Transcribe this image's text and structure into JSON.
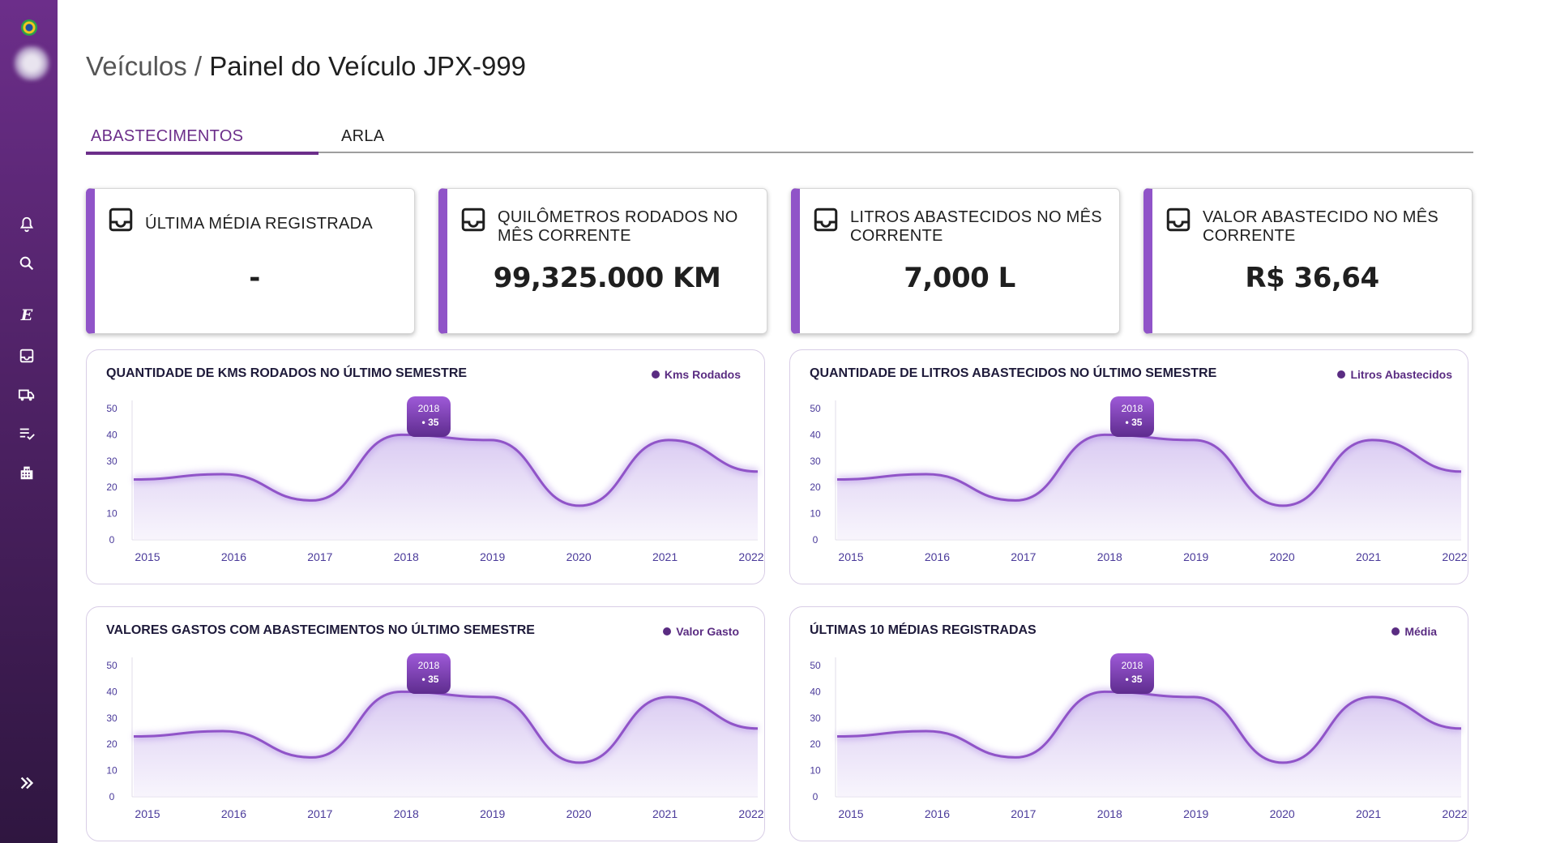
{
  "breadcrumb": {
    "parent": "Veículos",
    "separator": " / ",
    "current": "Painel do Veículo JPX-999"
  },
  "tabs": [
    {
      "label": "ABASTECIMENTOS",
      "active": true
    },
    {
      "label": "ARLA",
      "active": false
    }
  ],
  "sidebar": {
    "icons": [
      "flag-icon",
      "avatar",
      "bell-icon",
      "search-icon",
      "e-icon",
      "inbox-icon",
      "truck-icon",
      "checklist-icon",
      "building-icon",
      "double-chevron-right-icon"
    ],
    "e_label": "E"
  },
  "cards": [
    {
      "title": "ÚLTIMA MÉDIA REGISTRADA",
      "value": "-"
    },
    {
      "title": "QUILÔMETROS RODADOS NO MÊS CORRENTE",
      "value": "99,325.000 KM"
    },
    {
      "title": "LITROS ABASTECIDOS NO MÊS CORRENTE",
      "value": "7,000 L"
    },
    {
      "title": "VALOR ABASTECIDO NO MÊS CORRENTE",
      "value": "R$ 36,64"
    }
  ],
  "colors": {
    "accent": "#6c2e8a",
    "line": "#9054c8",
    "card_border": "#9054c8"
  },
  "charts": [
    {
      "title": "QUANTIDADE DE KMS RODADOS  NO ÚLTIMO SEMESTRE",
      "legend": "Kms Rodados",
      "tooltip_year": "2018",
      "tooltip_value": "• 35"
    },
    {
      "title": "QUANTIDADE DE LITROS ABASTECIDOS  NO ÚLTIMO SEMESTRE",
      "legend": "Litros Abastecidos",
      "tooltip_year": "2018",
      "tooltip_value": "• 35"
    },
    {
      "title": "VALORES GASTOS COM ABASTECIMENTOS NO ÚLTIMO SEMESTRE",
      "legend": "Valor Gasto",
      "tooltip_year": "2018",
      "tooltip_value": "• 35"
    },
    {
      "title": "ÚLTIMAS 10 MÉDIAS REGISTRADAS",
      "legend": "Média",
      "tooltip_year": "2018",
      "tooltip_value": "• 35"
    }
  ],
  "chart_data": [
    {
      "type": "area",
      "x": [
        "2015",
        "2016",
        "2017",
        "2018",
        "2019",
        "2020",
        "2021",
        "2022"
      ],
      "series": [
        {
          "name": "Kms Rodados",
          "values": [
            23,
            25,
            15,
            40,
            38,
            13,
            38,
            26
          ]
        }
      ],
      "ylim": [
        0,
        50
      ],
      "yticks": [
        0,
        10,
        20,
        30,
        40,
        50
      ]
    },
    {
      "type": "area",
      "x": [
        "2015",
        "2016",
        "2017",
        "2018",
        "2019",
        "2020",
        "2021",
        "2022"
      ],
      "series": [
        {
          "name": "Litros Abastecidos",
          "values": [
            23,
            25,
            15,
            40,
            38,
            13,
            38,
            26
          ]
        }
      ],
      "ylim": [
        0,
        50
      ],
      "yticks": [
        0,
        10,
        20,
        30,
        40,
        50
      ]
    },
    {
      "type": "area",
      "x": [
        "2015",
        "2016",
        "2017",
        "2018",
        "2019",
        "2020",
        "2021",
        "2022"
      ],
      "series": [
        {
          "name": "Valor Gasto",
          "values": [
            23,
            25,
            15,
            40,
            38,
            13,
            38,
            26
          ]
        }
      ],
      "ylim": [
        0,
        50
      ],
      "yticks": [
        0,
        10,
        20,
        30,
        40,
        50
      ]
    },
    {
      "type": "area",
      "x": [
        "2015",
        "2016",
        "2017",
        "2018",
        "2019",
        "2020",
        "2021",
        "2022"
      ],
      "series": [
        {
          "name": "Média",
          "values": [
            23,
            25,
            15,
            40,
            38,
            13,
            38,
            26
          ]
        }
      ],
      "ylim": [
        0,
        50
      ],
      "yticks": [
        0,
        10,
        20,
        30,
        40,
        50
      ]
    }
  ]
}
